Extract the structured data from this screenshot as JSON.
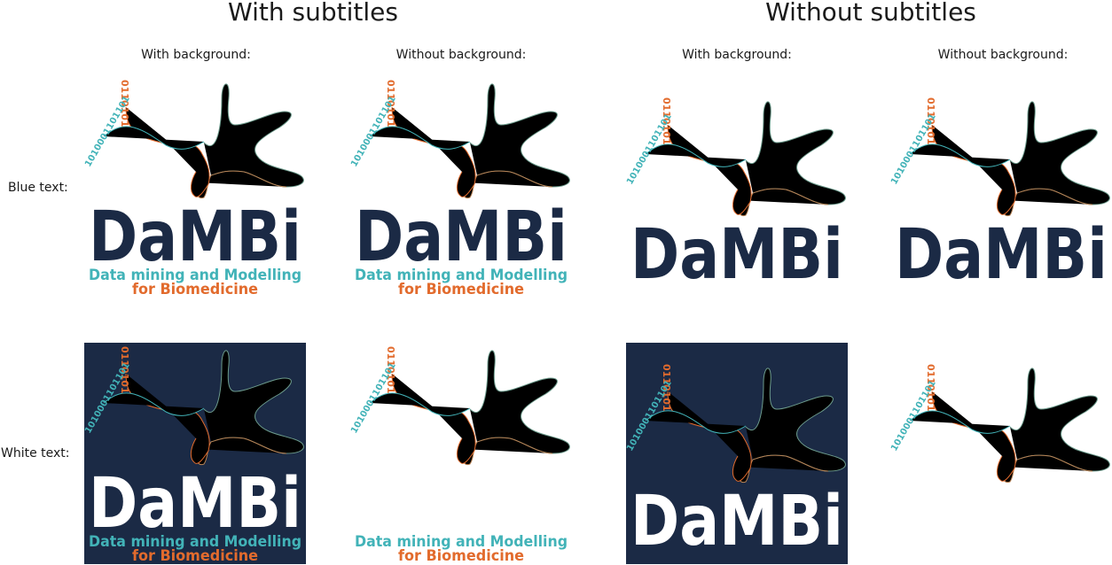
{
  "headers": {
    "with_subtitles": "With subtitles",
    "without_subtitles": "Without subtitles"
  },
  "columns": {
    "c1": "With background:",
    "c2": "Without background:",
    "c3": "With background:",
    "c4": "Without background:"
  },
  "rows": {
    "blue": "Blue text:",
    "white": "White text:"
  },
  "logo": {
    "wordmark": "DaMBi",
    "subtitle_line1": "Data mining and Modelling",
    "subtitle_line2": "for Biomedicine",
    "binary_orange": "0110101",
    "binary_teal": "1010001101101"
  },
  "colors": {
    "navy": "#1b2a45",
    "teal": "#42b3b8",
    "orange": "#e26b2d",
    "sage": "#6c9b8c",
    "tan": "#b88355",
    "white": "#ffffff"
  }
}
